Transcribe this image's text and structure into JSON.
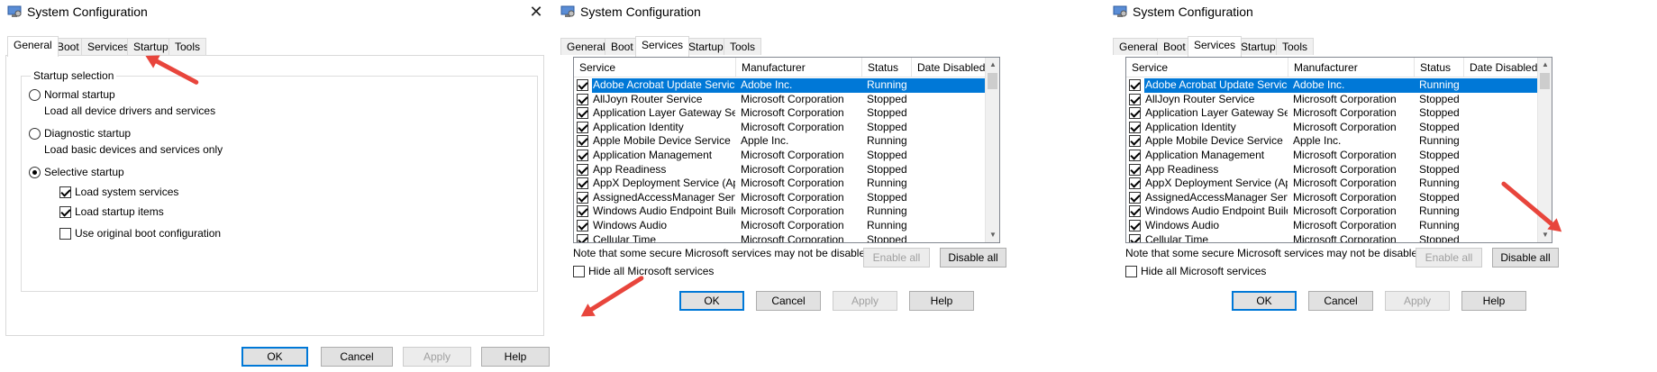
{
  "title": "System Configuration",
  "close_glyph": "✕",
  "tabs": [
    "General",
    "Boot",
    "Services",
    "Startup",
    "Tools"
  ],
  "general": {
    "group_title": "Startup selection",
    "normal_label": "Normal startup",
    "normal_desc": "Load all device drivers and services",
    "diagnostic_label": "Diagnostic startup",
    "diagnostic_desc": "Load basic devices and services only",
    "selective_label": "Selective startup",
    "load_system_services": "Load system services",
    "load_startup_items": "Load startup items",
    "use_original_boot": "Use original boot configuration"
  },
  "services": {
    "columns": [
      "Service",
      "Manufacturer",
      "Status",
      "Date Disabled"
    ],
    "rows": [
      {
        "service": "Adobe Acrobat Update Service",
        "manufacturer": "Adobe Inc.",
        "status": "Running"
      },
      {
        "service": "AllJoyn Router Service",
        "manufacturer": "Microsoft Corporation",
        "status": "Stopped"
      },
      {
        "service": "Application Layer Gateway Service",
        "manufacturer": "Microsoft Corporation",
        "status": "Stopped"
      },
      {
        "service": "Application Identity",
        "manufacturer": "Microsoft Corporation",
        "status": "Stopped"
      },
      {
        "service": "Apple Mobile Device Service",
        "manufacturer": "Apple Inc.",
        "status": "Running"
      },
      {
        "service": "Application Management",
        "manufacturer": "Microsoft Corporation",
        "status": "Stopped"
      },
      {
        "service": "App Readiness",
        "manufacturer": "Microsoft Corporation",
        "status": "Stopped"
      },
      {
        "service": "AppX Deployment Service (AppX...",
        "manufacturer": "Microsoft Corporation",
        "status": "Running"
      },
      {
        "service": "AssignedAccessManager Service",
        "manufacturer": "Microsoft Corporation",
        "status": "Stopped"
      },
      {
        "service": "Windows Audio Endpoint Builder",
        "manufacturer": "Microsoft Corporation",
        "status": "Running"
      },
      {
        "service": "Windows Audio",
        "manufacturer": "Microsoft Corporation",
        "status": "Running"
      },
      {
        "service": "Cellular Time",
        "manufacturer": "Microsoft Corporation",
        "status": "Stopped"
      }
    ],
    "note": "Note that some secure Microsoft services may not be disabled.",
    "hide_ms": "Hide all Microsoft services",
    "enable_all": "Enable all",
    "disable_all": "Disable all"
  },
  "buttons": {
    "ok": "OK",
    "cancel": "Cancel",
    "apply": "Apply",
    "help": "Help"
  },
  "colors": {
    "selection": "#0078d7",
    "arrow": "#e8453c"
  }
}
